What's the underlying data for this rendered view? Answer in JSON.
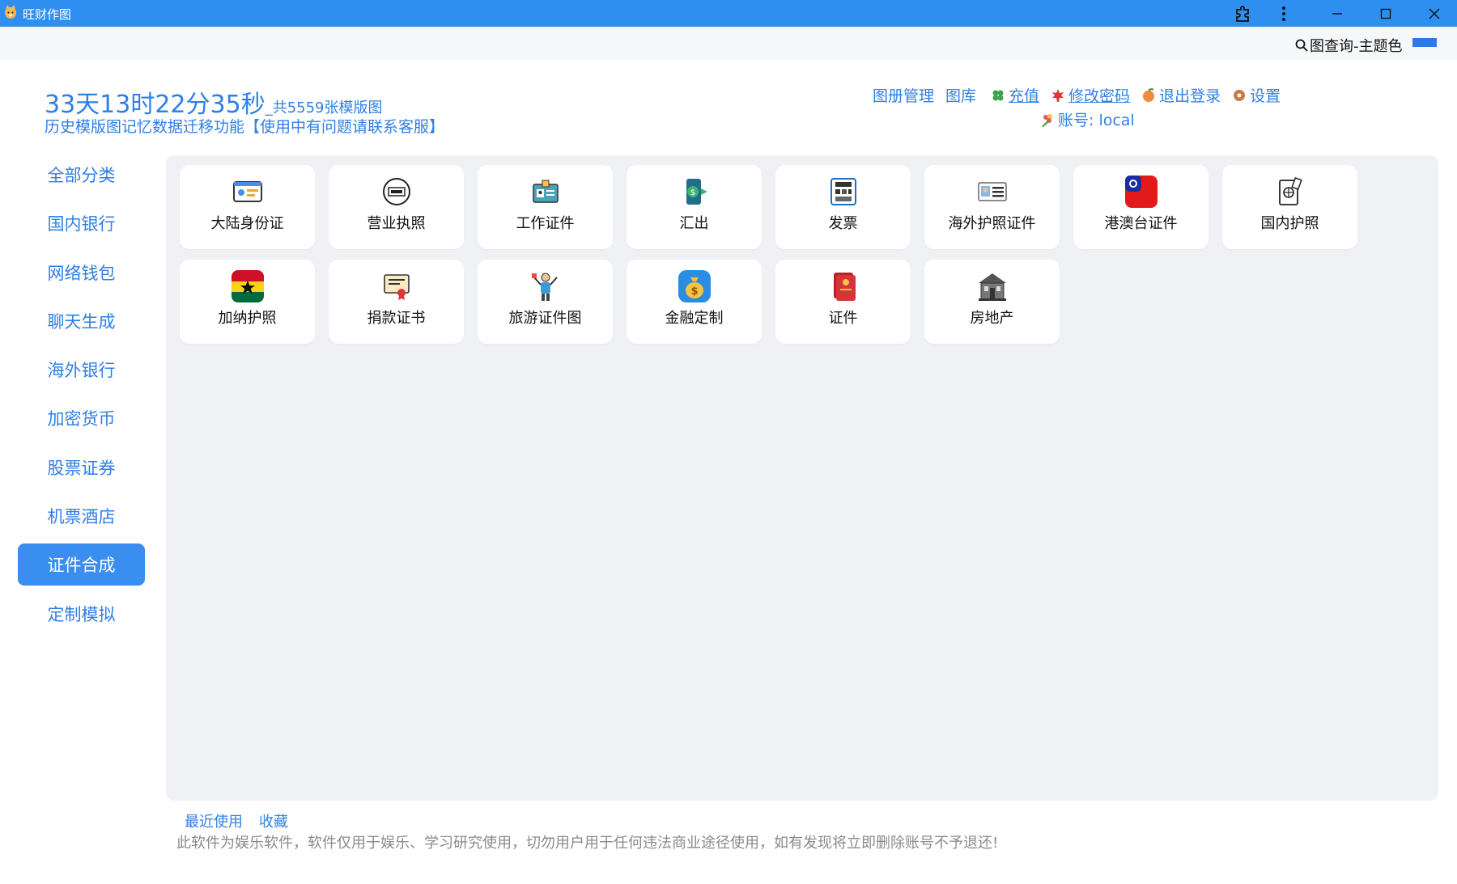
{
  "window": {
    "title": "旺财作图"
  },
  "subbar": {
    "search_label": "图查询-主题色",
    "theme_color": "#2f78ea"
  },
  "header": {
    "countdown": "33天13时22分35秒",
    "template_count": "_共5559张模版图",
    "notice": "历史模版图记忆数据迁移功能【使用中有问题请联系客服】",
    "links": {
      "album": "图册管理",
      "gallery": "图库",
      "recharge": "充值",
      "change_password": "修改密码",
      "logout": "退出登录",
      "settings": "设置"
    },
    "account": "账号: local"
  },
  "sidebar": {
    "items": [
      {
        "label": "全部分类"
      },
      {
        "label": "国内银行"
      },
      {
        "label": "网络钱包"
      },
      {
        "label": "聊天生成"
      },
      {
        "label": "海外银行"
      },
      {
        "label": "加密货币"
      },
      {
        "label": "股票证券"
      },
      {
        "label": "机票酒店"
      },
      {
        "label": "证件合成",
        "active": true
      },
      {
        "label": "定制模拟"
      }
    ]
  },
  "cards": [
    {
      "label": "大陆身份证",
      "icon": "id-card-icon"
    },
    {
      "label": "营业执照",
      "icon": "license-icon"
    },
    {
      "label": "工作证件",
      "icon": "work-badge-icon"
    },
    {
      "label": "汇出",
      "icon": "remit-icon"
    },
    {
      "label": "发票",
      "icon": "invoice-icon"
    },
    {
      "label": "海外护照证件",
      "icon": "overseas-id-icon"
    },
    {
      "label": "港澳台证件",
      "icon": "flag-icon"
    },
    {
      "label": "国内护照",
      "icon": "passport-icon"
    },
    {
      "label": "加纳护照",
      "icon": "ghana-flag-icon"
    },
    {
      "label": "捐款证书",
      "icon": "certificate-icon"
    },
    {
      "label": "旅游证件图",
      "icon": "traveler-icon"
    },
    {
      "label": "金融定制",
      "icon": "money-bag-icon"
    },
    {
      "label": "证件",
      "icon": "red-booklet-icon"
    },
    {
      "label": "房地产",
      "icon": "house-icon"
    }
  ],
  "footer": {
    "recent": "最近使用",
    "favorites": "收藏",
    "disclaimer": "此软件为娱乐软件，软件仅用于娱乐、学习研究使用，切勿用户用于任何违法商业途径使用，如有发现将立即删除账号不予退还!"
  }
}
